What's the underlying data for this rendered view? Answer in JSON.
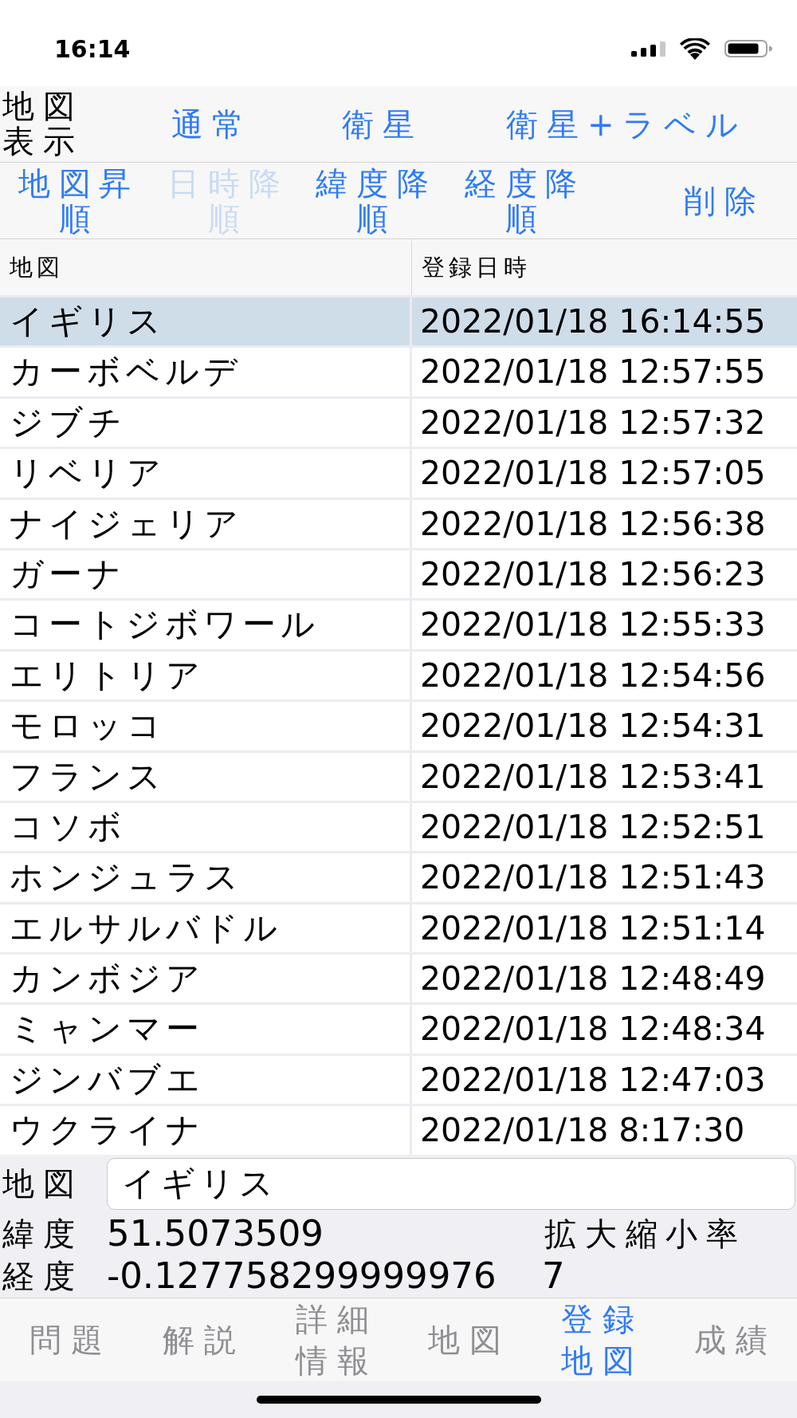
{
  "status_bar": {
    "time": "16:14"
  },
  "map_display": {
    "label": "地図表示",
    "buttons": [
      "通常",
      "衛星",
      "衛星+ラベル"
    ]
  },
  "sort_bar": {
    "buttons": [
      {
        "label": "地図昇順",
        "disabled": false
      },
      {
        "label": "日時降順",
        "disabled": true
      },
      {
        "label": "緯度降順",
        "disabled": false
      },
      {
        "label": "経度降順",
        "disabled": false
      }
    ],
    "delete_button": "削除"
  },
  "table": {
    "columns": [
      "地図",
      "登録日時"
    ],
    "rows": [
      {
        "cells": [
          "イギリス",
          "2022/01/18 16:14:55"
        ],
        "selected": true
      },
      {
        "cells": [
          "カーボベルデ",
          "2022/01/18 12:57:55"
        ],
        "selected": false
      },
      {
        "cells": [
          "ジブチ",
          "2022/01/18 12:57:32"
        ],
        "selected": false
      },
      {
        "cells": [
          "リベリア",
          "2022/01/18 12:57:05"
        ],
        "selected": false
      },
      {
        "cells": [
          "ナイジェリア",
          "2022/01/18 12:56:38"
        ],
        "selected": false
      },
      {
        "cells": [
          "ガーナ",
          "2022/01/18 12:56:23"
        ],
        "selected": false
      },
      {
        "cells": [
          "コートジボワール",
          "2022/01/18 12:55:33"
        ],
        "selected": false
      },
      {
        "cells": [
          "エリトリア",
          "2022/01/18 12:54:56"
        ],
        "selected": false
      },
      {
        "cells": [
          "モロッコ",
          "2022/01/18 12:54:31"
        ],
        "selected": false
      },
      {
        "cells": [
          "フランス",
          "2022/01/18 12:53:41"
        ],
        "selected": false
      },
      {
        "cells": [
          "コソボ",
          "2022/01/18 12:52:51"
        ],
        "selected": false
      },
      {
        "cells": [
          "ホンジュラス",
          "2022/01/18 12:51:43"
        ],
        "selected": false
      },
      {
        "cells": [
          "エルサルバドル",
          "2022/01/18 12:51:14"
        ],
        "selected": false
      },
      {
        "cells": [
          "カンボジア",
          "2022/01/18 12:48:49"
        ],
        "selected": false
      },
      {
        "cells": [
          "ミャンマー",
          "2022/01/18 12:48:34"
        ],
        "selected": false
      },
      {
        "cells": [
          "ジンバブエ",
          "2022/01/18 12:47:03"
        ],
        "selected": false
      },
      {
        "cells": [
          "ウクライナ",
          "2022/01/18 8:17:30"
        ],
        "selected": false
      }
    ]
  },
  "details": {
    "map": {
      "label": "地図",
      "value": "イギリス"
    },
    "latitude": {
      "label": "緯度",
      "value": "51.5073509"
    },
    "longitude": {
      "label": "経度",
      "value": "-0.127758299999976"
    },
    "zoom": {
      "label": "拡大縮小率",
      "value": "7"
    }
  },
  "tab_bar": {
    "tabs": [
      {
        "label": "問題",
        "selected": false
      },
      {
        "label": "解説",
        "selected": false
      },
      {
        "label": "詳細情報",
        "selected": false
      },
      {
        "label": "地図",
        "selected": false
      },
      {
        "label": "登録地図",
        "selected": true
      },
      {
        "label": "成績",
        "selected": false
      }
    ]
  }
}
